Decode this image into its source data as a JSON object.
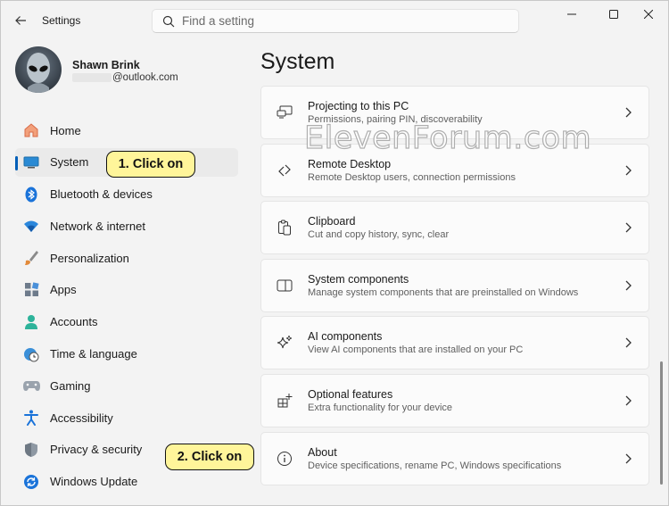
{
  "app": {
    "title": "Settings"
  },
  "search": {
    "placeholder": "Find a setting"
  },
  "user": {
    "name": "Shawn Brink",
    "email_suffix": "@outlook.com"
  },
  "nav": {
    "items": [
      {
        "label": "Home",
        "icon": "home-icon",
        "active": false
      },
      {
        "label": "System",
        "icon": "system-icon",
        "active": true
      },
      {
        "label": "Bluetooth & devices",
        "icon": "bluetooth-icon",
        "active": false
      },
      {
        "label": "Network & internet",
        "icon": "wifi-icon",
        "active": false
      },
      {
        "label": "Personalization",
        "icon": "brush-icon",
        "active": false
      },
      {
        "label": "Apps",
        "icon": "apps-icon",
        "active": false
      },
      {
        "label": "Accounts",
        "icon": "accounts-icon",
        "active": false
      },
      {
        "label": "Time & language",
        "icon": "clock-globe-icon",
        "active": false
      },
      {
        "label": "Gaming",
        "icon": "gamepad-icon",
        "active": false
      },
      {
        "label": "Accessibility",
        "icon": "accessibility-icon",
        "active": false
      },
      {
        "label": "Privacy & security",
        "icon": "shield-icon",
        "active": false
      },
      {
        "label": "Windows Update",
        "icon": "update-icon",
        "active": false
      }
    ]
  },
  "main": {
    "title": "System",
    "cards": [
      {
        "title": "Projecting to this PC",
        "desc": "Permissions, pairing PIN, discoverability",
        "icon": "projecting-icon"
      },
      {
        "title": "Remote Desktop",
        "desc": "Remote Desktop users, connection permissions",
        "icon": "remote-desktop-icon"
      },
      {
        "title": "Clipboard",
        "desc": "Cut and copy history, sync, clear",
        "icon": "clipboard-icon"
      },
      {
        "title": "System components",
        "desc": "Manage system components that are preinstalled on Windows",
        "icon": "components-icon"
      },
      {
        "title": "AI components",
        "desc": "View AI components that are installed on your PC",
        "icon": "sparkle-icon"
      },
      {
        "title": "Optional features",
        "desc": "Extra functionality for your device",
        "icon": "optional-features-icon"
      },
      {
        "title": "About",
        "desc": "Device specifications, rename PC, Windows specifications",
        "icon": "info-icon"
      }
    ]
  },
  "watermark": {
    "text": "ElevenForum.com"
  },
  "callouts": {
    "first": "1. Click on",
    "second": "2. Click on"
  },
  "colors": {
    "accent": "#005fb8",
    "callout": "#fff59a"
  }
}
